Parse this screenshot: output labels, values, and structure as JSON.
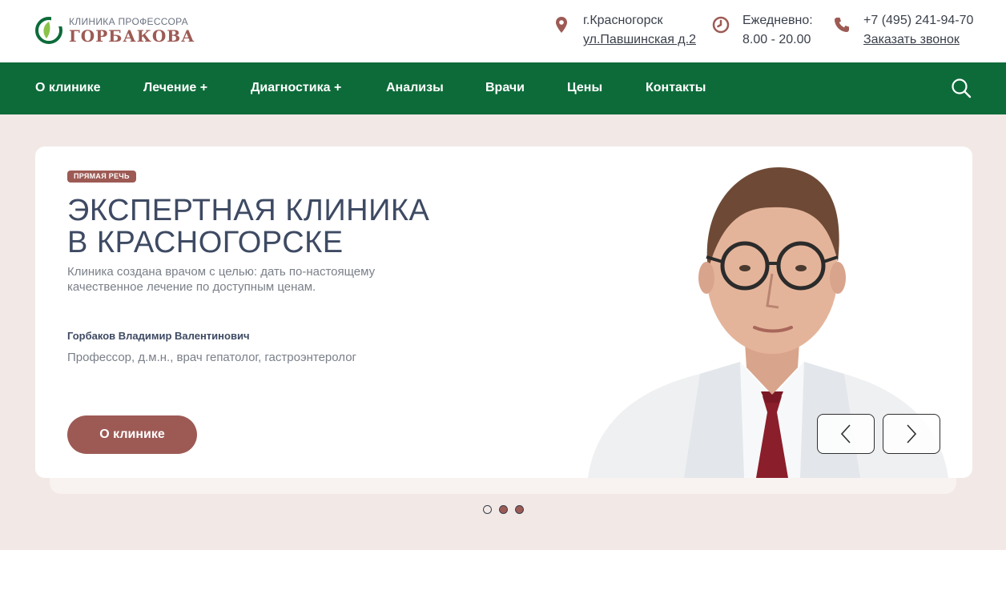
{
  "header": {
    "logo": {
      "top_line": "КЛИНИКА ПРОФЕССОРА",
      "bottom_line": "ГОРБАКОВА"
    },
    "address": {
      "city": "г.Красногорск",
      "street": "ул.Павшинская д.2"
    },
    "hours": {
      "label": "Ежедневно:",
      "value": "8.00 - 20.00"
    },
    "phone": {
      "number": "+7 (495) 241-94-70",
      "callback": "Заказать звонок"
    }
  },
  "nav": {
    "items": [
      {
        "label": "О клинике",
        "active": true
      },
      {
        "label": "Лечение +"
      },
      {
        "label": "Диагностика +"
      },
      {
        "label": "Анализы"
      },
      {
        "label": "Врачи"
      },
      {
        "label": "Цены"
      },
      {
        "label": "Контакты"
      }
    ],
    "search_icon": "search-icon"
  },
  "hero": {
    "badge": "ПРЯМАЯ РЕЧЬ",
    "title_line1": "ЭКСПЕРТНАЯ КЛИНИКА",
    "title_line2": "В КРАСНОГОРСКЕ",
    "subtitle": "Клиника создана врачом с целью: дать по-настоящему качественное лечение по доступным ценам.",
    "person_name": "Горбаков Владимир Валентинович",
    "person_role": "Профессор, д.м.н., врач гепатолог, гастроэнтеролог",
    "cta_label": "О клинике",
    "slides_total": 3,
    "active_slide": 1
  },
  "colors": {
    "brand_green": "#0d6b3a",
    "accent": "#9d5a54",
    "hero_bg": "#f2e9e7",
    "text_dark": "#3e4a63"
  }
}
